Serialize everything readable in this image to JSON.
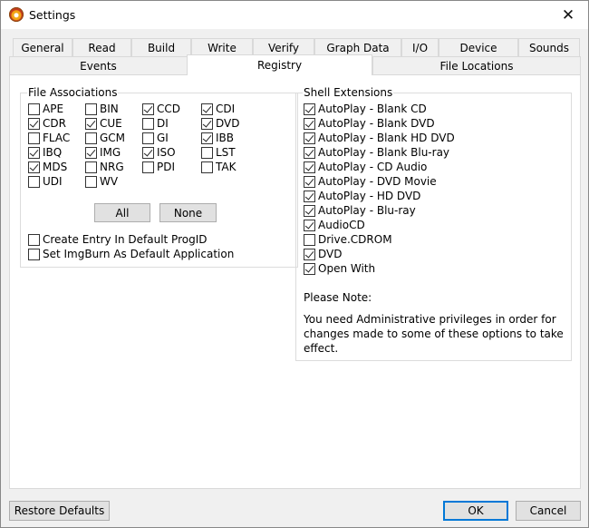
{
  "window": {
    "title": "Settings",
    "close": "✕"
  },
  "tabs_row1": [
    "General",
    "Read",
    "Build",
    "Write",
    "Verify",
    "Graph Data",
    "I/O",
    "Device",
    "Sounds"
  ],
  "tabs_row2": [
    "Events",
    "Registry",
    "File Locations"
  ],
  "active_tab": "Registry",
  "file_associations": {
    "title": "File Associations",
    "items": [
      {
        "label": "APE",
        "checked": false
      },
      {
        "label": "BIN",
        "checked": false
      },
      {
        "label": "CCD",
        "checked": true
      },
      {
        "label": "CDI",
        "checked": true
      },
      {
        "label": "CDR",
        "checked": true
      },
      {
        "label": "CUE",
        "checked": true
      },
      {
        "label": "DI",
        "checked": false
      },
      {
        "label": "DVD",
        "checked": true
      },
      {
        "label": "FLAC",
        "checked": false
      },
      {
        "label": "GCM",
        "checked": false
      },
      {
        "label": "GI",
        "checked": false
      },
      {
        "label": "IBB",
        "checked": true
      },
      {
        "label": "IBQ",
        "checked": true
      },
      {
        "label": "IMG",
        "checked": true
      },
      {
        "label": "ISO",
        "checked": true
      },
      {
        "label": "LST",
        "checked": false
      },
      {
        "label": "MDS",
        "checked": true
      },
      {
        "label": "NRG",
        "checked": false
      },
      {
        "label": "PDI",
        "checked": false
      },
      {
        "label": "TAK",
        "checked": false
      },
      {
        "label": "UDI",
        "checked": false
      },
      {
        "label": "WV",
        "checked": false
      }
    ],
    "all_button": "All",
    "none_button": "None",
    "options": [
      {
        "label": "Create Entry In Default ProgID",
        "checked": false
      },
      {
        "label": "Set ImgBurn As Default Application",
        "checked": false
      }
    ]
  },
  "shell_extensions": {
    "title": "Shell Extensions",
    "items": [
      {
        "label": "AutoPlay - Blank CD",
        "checked": true
      },
      {
        "label": "AutoPlay - Blank DVD",
        "checked": true
      },
      {
        "label": "AutoPlay - Blank HD DVD",
        "checked": true
      },
      {
        "label": "AutoPlay - Blank Blu-ray",
        "checked": true
      },
      {
        "label": "AutoPlay - CD Audio",
        "checked": true
      },
      {
        "label": "AutoPlay - DVD Movie",
        "checked": true
      },
      {
        "label": "AutoPlay - HD DVD",
        "checked": true
      },
      {
        "label": "AutoPlay - Blu-ray",
        "checked": true
      },
      {
        "label": "AudioCD",
        "checked": true
      },
      {
        "label": "Drive.CDROM",
        "checked": false
      },
      {
        "label": "DVD",
        "checked": true
      },
      {
        "label": "Open With",
        "checked": true
      }
    ],
    "note_title": "Please Note:",
    "note_line1": "You need Administrative privileges in order for",
    "note_line2": "changes made to some of these options to take effect."
  },
  "footer": {
    "restore_defaults": "Restore Defaults",
    "ok": "OK",
    "cancel": "Cancel"
  }
}
